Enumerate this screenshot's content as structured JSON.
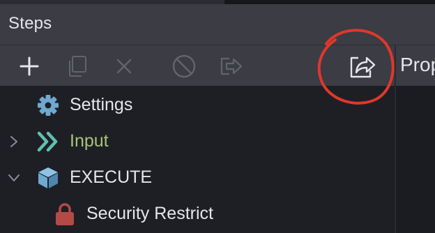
{
  "panel": {
    "title": "Steps"
  },
  "properties": {
    "title": "Prop"
  },
  "toolbar": {
    "buttons": [
      {
        "name": "add-step-button",
        "icon": "plus-icon"
      },
      {
        "name": "duplicate-step-button",
        "icon": "copy-icon"
      },
      {
        "name": "delete-step-button",
        "icon": "close-icon"
      },
      {
        "name": "disable-step-button",
        "icon": "disable-icon"
      },
      {
        "name": "move-step-button",
        "icon": "arrow-right-box-icon"
      },
      {
        "name": "export-step-button",
        "icon": "share-icon"
      }
    ]
  },
  "tree": {
    "items": [
      {
        "label": "Settings",
        "icon": "gear-icon",
        "expander": "none"
      },
      {
        "label": "Input",
        "icon": "double-chevron-right-icon",
        "expander": "collapsed"
      },
      {
        "label": "EXECUTE",
        "icon": "cube-icon",
        "expander": "expanded"
      },
      {
        "label": "Security Restrict",
        "icon": "lock-icon",
        "expander": "none"
      }
    ]
  },
  "colors": {
    "panel_bg": "#3b3c44",
    "tree_bg": "#1e1f25",
    "text": "#e6e6ea",
    "icon_disabled": "#62646d",
    "icon_enabled": "#e6e6ea",
    "accent_blue": "#6fa9cf",
    "input_green": "#a6c47a",
    "teal": "#62bfae",
    "lock_red": "#b34a45",
    "annotation_red": "#e0372b"
  }
}
